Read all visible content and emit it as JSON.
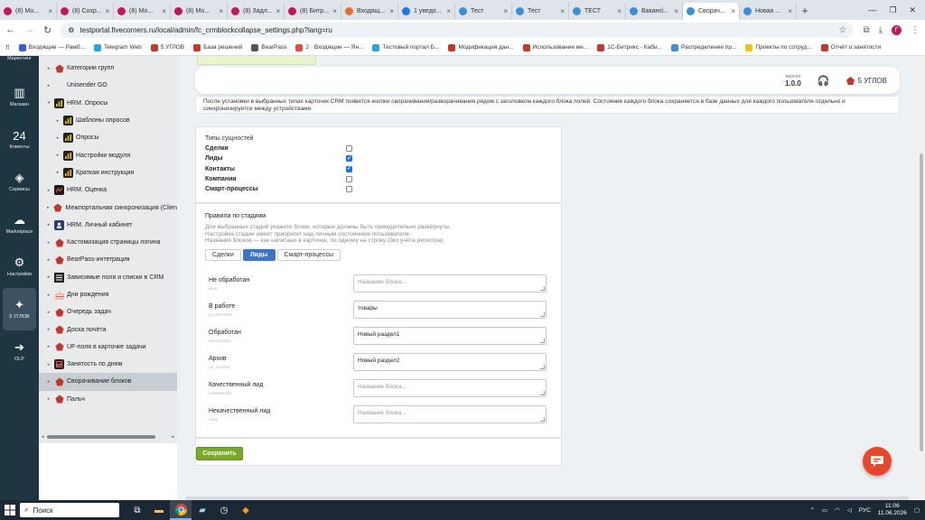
{
  "browser": {
    "tabs": [
      {
        "label": "(8) Мо...",
        "color": "#c2185b"
      },
      {
        "label": "(8) Сохр...",
        "color": "#c2185b"
      },
      {
        "label": "(8) Мо...",
        "color": "#c2185b"
      },
      {
        "label": "(8) Мо...",
        "color": "#c2185b"
      },
      {
        "label": "(8) Задл...",
        "color": "#c2185b"
      },
      {
        "label": "(8) Битр...",
        "color": "#c2185b"
      },
      {
        "label": "Входящ...",
        "color": "#ea6f2e"
      },
      {
        "label": "1 уведо...",
        "color": "#1a73e8"
      },
      {
        "label": "Тест",
        "color": "#3a8fd9"
      },
      {
        "label": "Тест",
        "color": "#3a8fd9"
      },
      {
        "label": "ТЕСТ",
        "color": "#3a8fd9"
      },
      {
        "label": "Вакансі...",
        "color": "#3a8fd9"
      },
      {
        "label": "Сворач...",
        "color": "#3a8fd9",
        "active": true
      },
      {
        "label": "Новая ...",
        "color": "#3a8fd9"
      }
    ],
    "new_tab": "+",
    "url": "testportal.fivecorners.ru/local/admin/fc_crmblockcollapse_settings.php?lang=ru",
    "profile_initial": "Г",
    "bookmarks": [
      {
        "label": "Входящие — Рамб...",
        "color": "#3b5bdb"
      },
      {
        "label": "Telegram Web",
        "color": "#2aa3e0"
      },
      {
        "label": "5 УГЛОВ",
        "color": "#c0392b"
      },
      {
        "label": "База решений",
        "color": "#c0392b"
      },
      {
        "label": "BearPass",
        "color": "#555"
      },
      {
        "label": "2 · Входящие — Ян...",
        "color": "#e74c3c"
      },
      {
        "label": "Тестовый портал Б...",
        "color": "#2aa3e0"
      },
      {
        "label": "Модификация дан...",
        "color": "#c0392b"
      },
      {
        "label": "Использование ме...",
        "color": "#c0392b"
      },
      {
        "label": "1С-Битрикс - Каби...",
        "color": "#c0392b"
      },
      {
        "label": "Распределение пр...",
        "color": "#3a8fd9"
      },
      {
        "label": "Проекты по сотруд...",
        "color": "#f1c40f"
      },
      {
        "label": "Отчёт о занятости",
        "color": "#c0392b"
      }
    ]
  },
  "left_nav": [
    {
      "label": "Маркетинг",
      "icon": "megaphone-icon",
      "glyph": "📣"
    },
    {
      "label": "Магазин",
      "icon": "shop-icon",
      "glyph": "▥"
    },
    {
      "label": "Клиенты",
      "icon": "clients-icon",
      "glyph": "24"
    },
    {
      "label": "Сервисы",
      "icon": "services-icon",
      "glyph": "◈"
    },
    {
      "label": "Marketplace",
      "icon": "cloud-icon",
      "glyph": "☁"
    },
    {
      "label": "Настройки",
      "icon": "gear-icon",
      "glyph": "⚙"
    },
    {
      "label": "5 УГЛОВ",
      "icon": "fivecorners-icon",
      "glyph": "✦",
      "active": true
    },
    {
      "label": "OLP",
      "icon": "olp-icon",
      "glyph": "➔"
    }
  ],
  "tree": [
    {
      "label": "",
      "tri": "",
      "icon": "",
      "level": 1,
      "partial": true
    },
    {
      "label": "Категории групп",
      "tri": "▸",
      "icon": "fc",
      "level": 1
    },
    {
      "label": "Unisender GO",
      "tri": "▸",
      "icon": "",
      "level": 1
    },
    {
      "label": "HRM. Опросы",
      "tri": "▾",
      "icon": "bars",
      "level": 1
    },
    {
      "label": "Шаблоны опросов",
      "tri": "▸",
      "icon": "bars",
      "level": 2
    },
    {
      "label": "Опросы",
      "tri": "▸",
      "icon": "bars",
      "level": 2
    },
    {
      "label": "Настройки модуля",
      "tri": "▸",
      "icon": "bars",
      "level": 2
    },
    {
      "label": "Краткая инструкция",
      "tri": "▸",
      "icon": "bars",
      "level": 2
    },
    {
      "label": "HRM. Оценка",
      "tri": "▸",
      "icon": "hrm",
      "level": 1
    },
    {
      "label": "Межпортальная синхронизация (Clien",
      "tri": "▸",
      "icon": "fc",
      "level": 1
    },
    {
      "label": "HRM. Личный кабинет",
      "tri": "▸",
      "icon": "hrmlk",
      "level": 1
    },
    {
      "label": "Кастомизация страницы логина",
      "tri": "▸",
      "icon": "fc",
      "level": 1
    },
    {
      "label": "BearPass-интеграция",
      "tri": "▸",
      "icon": "fc",
      "level": 1
    },
    {
      "label": "Зависимые поля и списки в CRM",
      "tri": "▸",
      "icon": "list",
      "level": 1
    },
    {
      "label": "Дни рождения",
      "tri": "▸",
      "icon": "bday",
      "level": 1
    },
    {
      "label": "Очередь задач",
      "tri": "▸",
      "icon": "fc",
      "level": 1
    },
    {
      "label": "Доска почёта",
      "tri": "▸",
      "icon": "fc",
      "level": 1
    },
    {
      "label": "UF-поля в карточке задачи",
      "tri": "▸",
      "icon": "fc",
      "level": 1
    },
    {
      "label": "Занятость по дням",
      "tri": "▸",
      "icon": "ep",
      "level": 1
    },
    {
      "label": "Сворачивание блоков",
      "tri": "▸",
      "icon": "fc",
      "level": 1,
      "selected": true
    },
    {
      "label": "Пальч",
      "tri": "▸",
      "icon": "fc",
      "level": 1
    }
  ],
  "widget": {
    "version_label": "версия",
    "version": "1.0.0",
    "brand": "5 УГЛОВ"
  },
  "note": "После установки в выбранных типах карточек CRM появятся кнопки сворачивания/разворачивания рядом с заголовком каждого блока полей. Состояние каждого блока сохраняется в базе данных для каждого пользователя отдельно и синхронизируется между устройствами.",
  "entities": {
    "title": "Типы сущностей",
    "items": [
      {
        "label": "Сделки",
        "checked": false
      },
      {
        "label": "Лиды",
        "checked": true
      },
      {
        "label": "Контакты",
        "checked": true
      },
      {
        "label": "Компании",
        "checked": false
      },
      {
        "label": "Смарт-процессы",
        "checked": false
      }
    ]
  },
  "rules": {
    "title": "Правила по стадиям",
    "hint": [
      "Для выбранных стадий укажите блоки, которые должны быть принудительно развёрнуты.",
      "Настройка стадии имеет приоритет над личным состоянием пользователя.",
      "Названия блоков — как написано в карточке, по одному на строку (без учёта регистра)."
    ],
    "tabs": [
      {
        "label": "Сделки"
      },
      {
        "label": "Лиды",
        "active": true
      },
      {
        "label": "Смарт-процессы"
      }
    ],
    "stages": [
      {
        "name": "Не обработан",
        "code": "NEW",
        "value": "",
        "placeholder": "Название блока..."
      },
      {
        "name": "В работе",
        "code": "IN_PROCESS",
        "value": "товары",
        "placeholder": "Название блока..."
      },
      {
        "name": "Обработан",
        "code": "PROCESSED",
        "value": "Новый раздел1",
        "placeholder": "Название блока..."
      },
      {
        "name": "Архив",
        "code": "UC_AGJTEA",
        "value": "Новый раздел2",
        "placeholder": "Название блока..."
      },
      {
        "name": "Качественный лид",
        "code": "CONVERTED",
        "value": "",
        "placeholder": "Название блока..."
      },
      {
        "name": "Некачественный лид",
        "code": "JUNK",
        "value": "",
        "placeholder": "Название блока..."
      }
    ]
  },
  "save_label": "Сохранить",
  "taskbar": {
    "search": "Поиск",
    "lang": "РУС",
    "time": "11:06",
    "date": "11.06.2026"
  }
}
